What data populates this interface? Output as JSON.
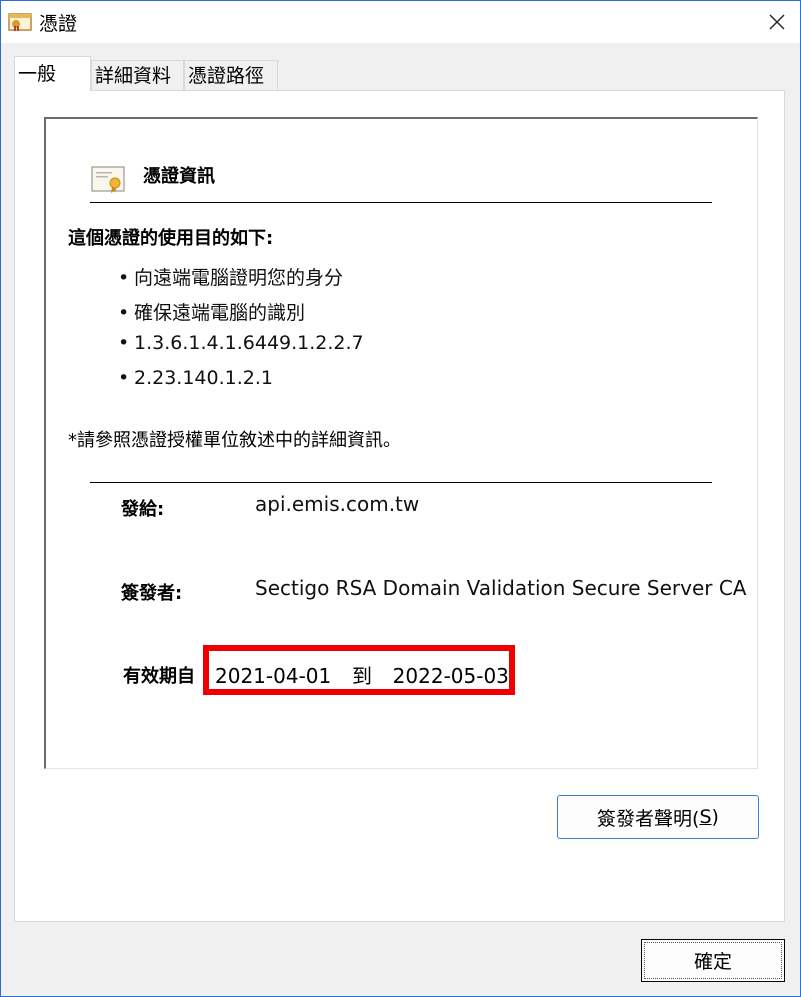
{
  "window": {
    "title": "憑證"
  },
  "tabs": [
    {
      "label": "一般"
    },
    {
      "label": "詳細資料"
    },
    {
      "label": "憑證路徑"
    }
  ],
  "cert": {
    "heading": "憑證資訊",
    "purpose_title": "這個憑證的使用目的如下:",
    "purposes": [
      "向遠端電腦證明您的身分",
      "確保遠端電腦的識別",
      "1.3.6.1.4.1.6449.1.2.2.7",
      "2.23.140.1.2.1"
    ],
    "note": "*請參照憑證授權單位敘述中的詳細資訊。",
    "issued_to_label": "發給:",
    "issued_to": "api.emis.com.tw",
    "issued_by_label": "簽發者:",
    "issued_by": "Sectigo RSA Domain Validation Secure Server CA",
    "valid_label": "有效期自",
    "valid_from": "2021-04-01",
    "valid_sep": "到",
    "valid_to": "2022-05-03"
  },
  "buttons": {
    "issuer_statement": "簽發者聲明(",
    "issuer_statement_key": "S",
    "issuer_statement_end": ")",
    "ok": "確定"
  },
  "colors": {
    "highlight": "#ee0000",
    "accent": "#2b6fd6"
  },
  "icons": {
    "title": "certificate-icon",
    "close": "close-icon",
    "cert": "certificate-icon"
  }
}
